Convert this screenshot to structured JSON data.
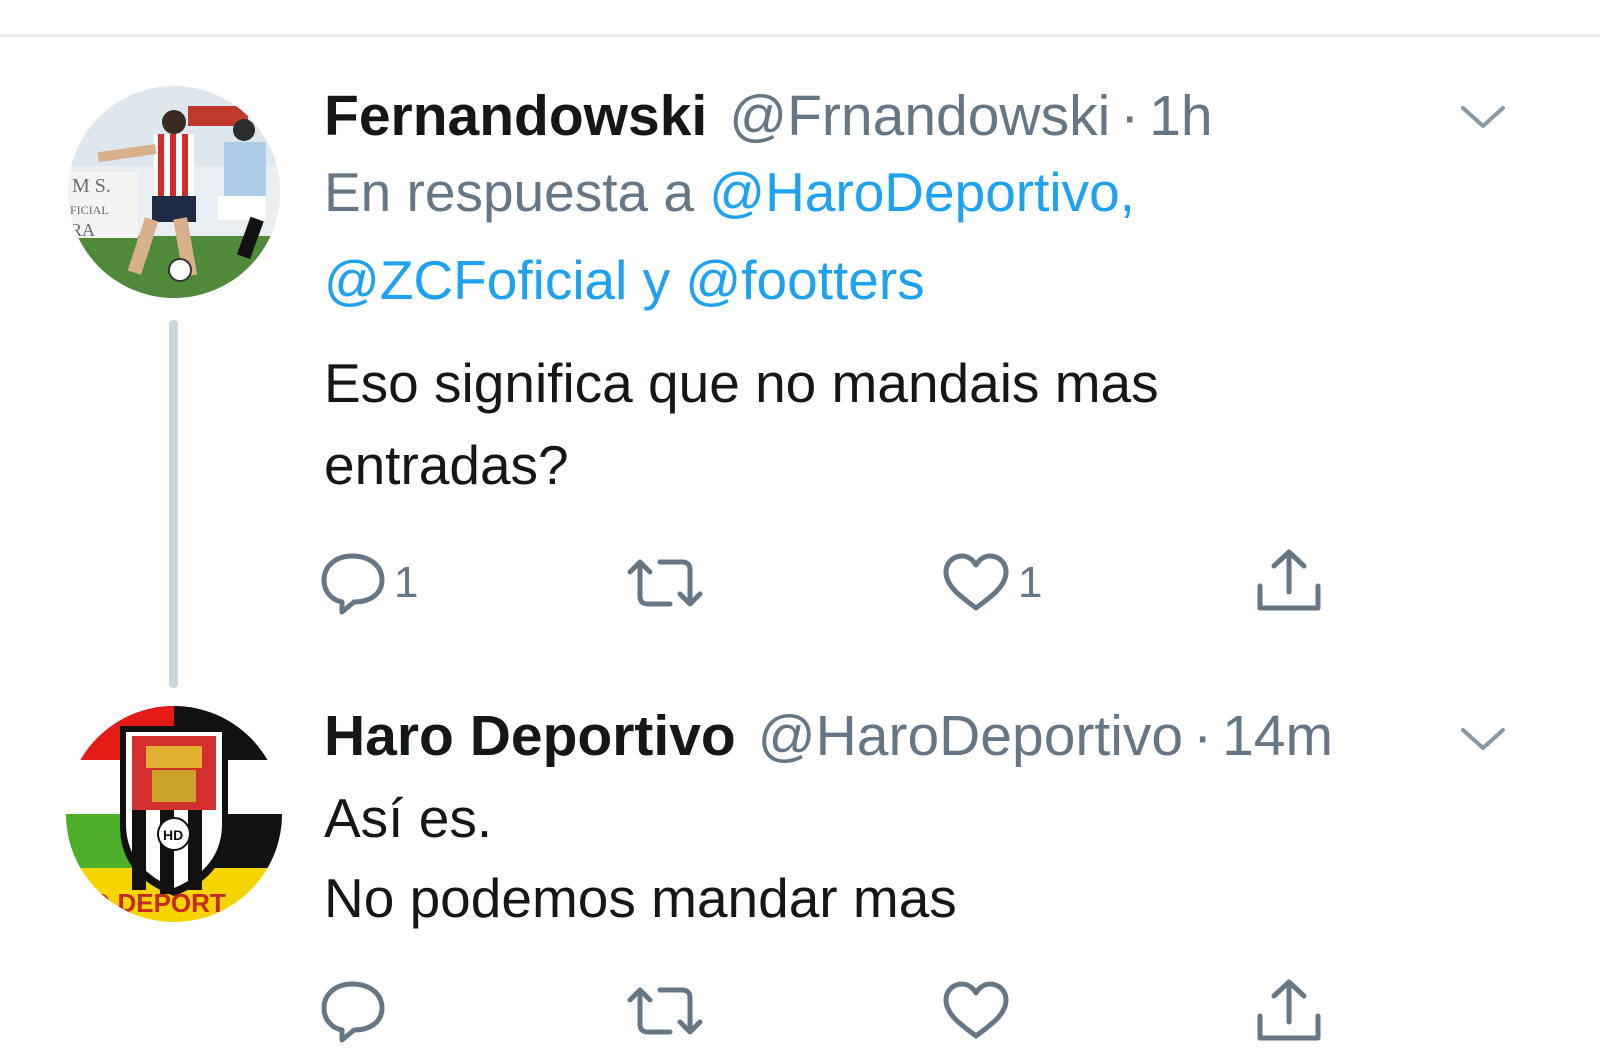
{
  "tweets": [
    {
      "name": "Fernandowski",
      "handle": "@Frnandowski",
      "separator": "·",
      "time": "1h",
      "reply_prefix": "En respuesta a",
      "reply_mentions": [
        "@HaroDeportivo,",
        "@ZCFoficial",
        "@footters"
      ],
      "reply_joiner": "y",
      "text_lines": [
        "Eso significa que no mandais mas",
        "entradas?"
      ],
      "reply_count": "1",
      "like_count": "1",
      "avatar_text": [
        "M S.",
        "FICIAL",
        "RA"
      ]
    },
    {
      "name": "Haro Deportivo",
      "handle": "@HaroDeportivo",
      "separator": "·",
      "time": "14m",
      "text_lines": [
        "Así es.",
        "No podemos mandar mas"
      ],
      "avatar_text": [
        "HD",
        "O DEPORT"
      ]
    }
  ],
  "colors": {
    "accent": "#1da1f2",
    "muted": "#657786",
    "text": "#14171a",
    "line": "#ccd6dd"
  },
  "icons": [
    "reply-icon",
    "retweet-icon",
    "like-icon",
    "share-icon",
    "chevron-down-icon"
  ]
}
